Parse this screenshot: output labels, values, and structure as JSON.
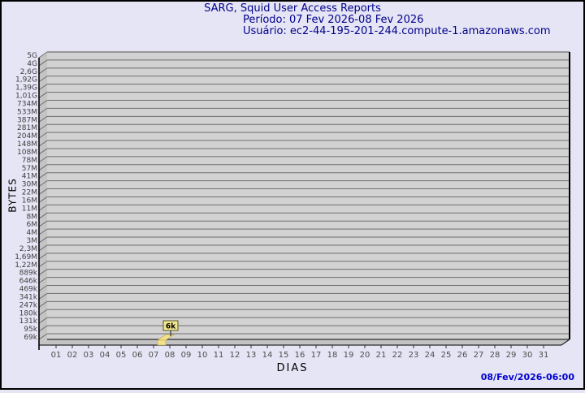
{
  "header": {
    "title": "SARG, Squid User Access Reports",
    "period": "Período: 07 Fev 2026-08 Fev 2026",
    "user": "Usuário: ec2-44-195-201-244.compute-1.amazonaws.com"
  },
  "footer": {
    "timestamp": "08/Fev/2026-06:00"
  },
  "chart_data": {
    "type": "bar",
    "projection": "3d",
    "title": "SARG, Squid User Access Reports",
    "xlabel": "DIAS",
    "ylabel": "BYTES",
    "y_scale": "logarithmic",
    "ylim_labels": [
      "69k",
      "5G"
    ],
    "grid": "horizontal",
    "y_axis_labels": [
      "5G",
      "4G",
      "2,6G",
      "1,92G",
      "1,39G",
      "1,01G",
      "734M",
      "533M",
      "387M",
      "281M",
      "204M",
      "148M",
      "108M",
      "78M",
      "57M",
      "41M",
      "30M",
      "22M",
      "16M",
      "11M",
      "8M",
      "6M",
      "4M",
      "3M",
      "2,3M",
      "1,69M",
      "1,22M",
      "889k",
      "646k",
      "469k",
      "341k",
      "247k",
      "180k",
      "131k",
      "95k",
      "69k"
    ],
    "x_axis_labels": [
      "01",
      "02",
      "03",
      "04",
      "05",
      "06",
      "07",
      "08",
      "09",
      "10",
      "11",
      "12",
      "13",
      "14",
      "15",
      "16",
      "17",
      "18",
      "19",
      "20",
      "21",
      "22",
      "23",
      "24",
      "25",
      "26",
      "27",
      "28",
      "29",
      "30",
      "31"
    ],
    "bars": [
      {
        "x_label": "08",
        "value_label": "6k",
        "approx_bytes": 6000
      }
    ],
    "colors": {
      "background": "#e5e5f5",
      "border": "#000000",
      "header_text": "#00008b",
      "timestamp_text": "#0000cd",
      "plot_face": "#d2d2d2",
      "plot_side": "#c4c4c4",
      "grid_line": "#6e6e6e",
      "axis_line": "#000000",
      "y_tick_text": "#3f3f3f",
      "x_tick_text": "#4d4d4d",
      "bar_fill": "#f5e18a",
      "bar_edge": "#b5a14a",
      "label_box_fill": "#f0e68c",
      "label_box_border": "#55552a",
      "label_text": "#000000"
    }
  }
}
